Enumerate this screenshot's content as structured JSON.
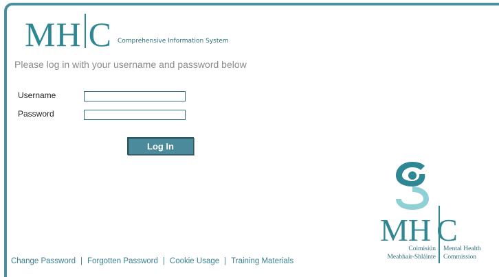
{
  "header": {
    "logo_left": "MH",
    "logo_right": "C",
    "system_name": "Comprehensive Information System"
  },
  "login": {
    "prompt": "Please log in with your username and password below",
    "username_label": "Username",
    "password_label": "Password",
    "username_value": "",
    "password_value": "",
    "button_label": "Log In"
  },
  "footer": {
    "links": [
      "Change Password",
      "Forgotten Password",
      "Cookie Usage",
      "Training Materials"
    ],
    "separator": "|"
  },
  "brand": {
    "mark_left": "MH",
    "mark_right": "C",
    "irish_line1": "Coimisiún",
    "irish_line2": "Meabhair-Shláinte",
    "english_line1": "Mental Health",
    "english_line2": "Commission"
  },
  "colors": {
    "accent": "#2f8793",
    "button": "#4a8a9a",
    "border": "#4a8f9c"
  }
}
